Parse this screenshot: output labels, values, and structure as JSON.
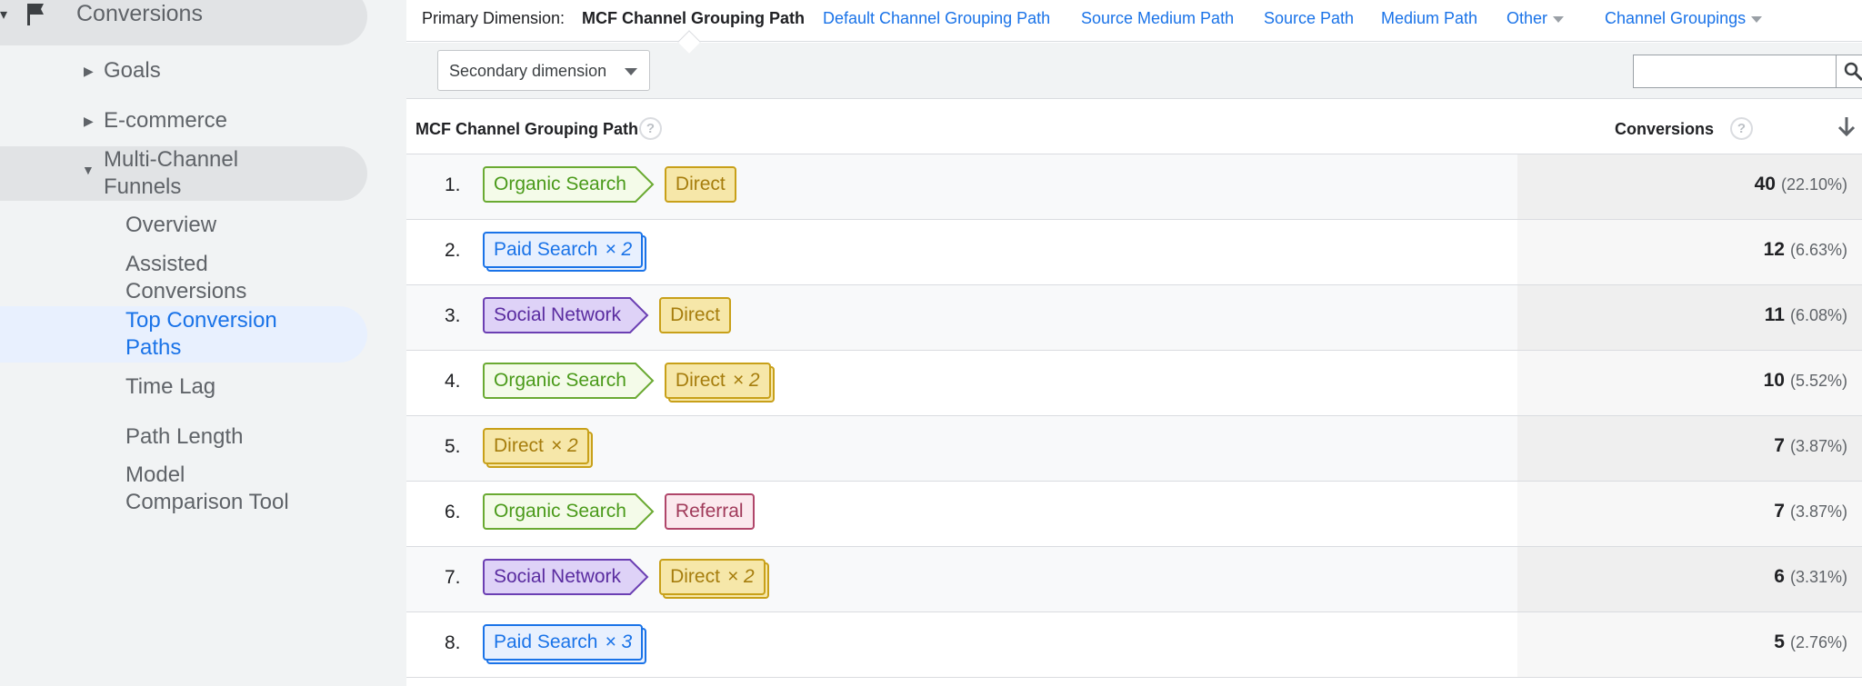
{
  "sidebar": {
    "section_title": "Conversions",
    "goals": "Goals",
    "ecommerce": "E-commerce",
    "mcf_line1": "Multi-Channel",
    "mcf_line2": "Funnels",
    "overview": "Overview",
    "assisted_line1": "Assisted",
    "assisted_line2": "Conversions",
    "top_paths_line1": "Top Conversion",
    "top_paths_line2": "Paths",
    "time_lag": "Time Lag",
    "path_length": "Path Length",
    "model_line1": "Model",
    "model_line2": "Comparison Tool"
  },
  "dimensions": {
    "label": "Primary Dimension:",
    "current": "MCF Channel Grouping Path",
    "default_channel": "Default Channel Grouping Path",
    "source_medium": "Source Medium Path",
    "source": "Source Path",
    "medium": "Medium Path",
    "other": "Other",
    "channel_groupings": "Channel Groupings"
  },
  "toolbar": {
    "secondary_dimension": "Secondary dimension",
    "search_value": ""
  },
  "table": {
    "col_path": "MCF Channel Grouping Path",
    "col_conversions": "Conversions",
    "help_glyph": "?",
    "rows": [
      {
        "num": "1.",
        "value": "40",
        "pct": "(22.10%)",
        "chips": [
          {
            "label": "Organic Search",
            "type": "organic",
            "mult": ""
          },
          {
            "label": "Direct",
            "type": "direct",
            "mult": ""
          }
        ]
      },
      {
        "num": "2.",
        "value": "12",
        "pct": "(6.63%)",
        "chips": [
          {
            "label": "Paid Search",
            "type": "paid",
            "mult": "× 2"
          }
        ]
      },
      {
        "num": "3.",
        "value": "11",
        "pct": "(6.08%)",
        "chips": [
          {
            "label": "Social Network",
            "type": "social",
            "mult": ""
          },
          {
            "label": "Direct",
            "type": "direct",
            "mult": ""
          }
        ]
      },
      {
        "num": "4.",
        "value": "10",
        "pct": "(5.52%)",
        "chips": [
          {
            "label": "Organic Search",
            "type": "organic",
            "mult": ""
          },
          {
            "label": "Direct",
            "type": "direct",
            "mult": "× 2"
          }
        ]
      },
      {
        "num": "5.",
        "value": "7",
        "pct": "(3.87%)",
        "chips": [
          {
            "label": "Direct",
            "type": "direct",
            "mult": "× 2"
          }
        ]
      },
      {
        "num": "6.",
        "value": "7",
        "pct": "(3.87%)",
        "chips": [
          {
            "label": "Organic Search",
            "type": "organic",
            "mult": ""
          },
          {
            "label": "Referral",
            "type": "referral",
            "mult": ""
          }
        ]
      },
      {
        "num": "7.",
        "value": "6",
        "pct": "(3.31%)",
        "chips": [
          {
            "label": "Social Network",
            "type": "social",
            "mult": ""
          },
          {
            "label": "Direct",
            "type": "direct",
            "mult": "× 2"
          }
        ]
      },
      {
        "num": "8.",
        "value": "5",
        "pct": "(2.76%)",
        "chips": [
          {
            "label": "Paid Search",
            "type": "paid",
            "mult": "× 3"
          }
        ]
      }
    ]
  },
  "icons": {
    "section": "flag-icon",
    "search": "search-icon",
    "sort": "arrow-down-icon"
  },
  "colors": {
    "accent": "#1a73e8",
    "organic": "#6aaa32",
    "direct": "#c8a019",
    "paid": "#1a73e8",
    "social": "#6b3fb3",
    "referral": "#b0466a"
  }
}
